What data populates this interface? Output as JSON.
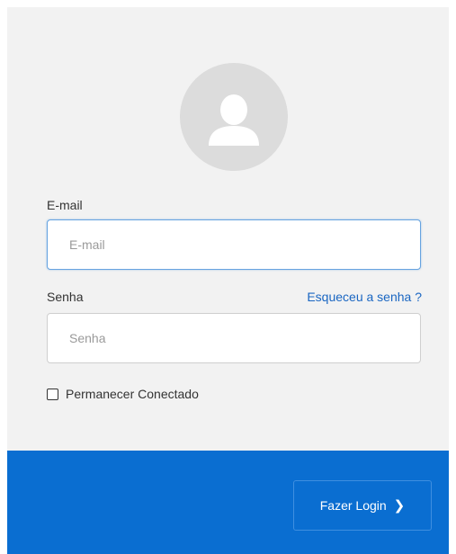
{
  "form": {
    "email_label": "E-mail",
    "email_placeholder": "E-mail",
    "password_label": "Senha",
    "password_placeholder": "Senha",
    "forgot_link": "Esqueceu a senha ?",
    "remember_label": "Permanecer Conectado",
    "remember_checked": false
  },
  "footer": {
    "login_label": "Fazer Login",
    "login_icon": "chevron-right-icon"
  },
  "avatar": {
    "icon": "user-icon"
  },
  "colors": {
    "panel_bg": "#f2f2f2",
    "footer_bg": "#0a6ed1",
    "link": "#1a66c2",
    "avatar_bg": "#dcdcdc"
  }
}
